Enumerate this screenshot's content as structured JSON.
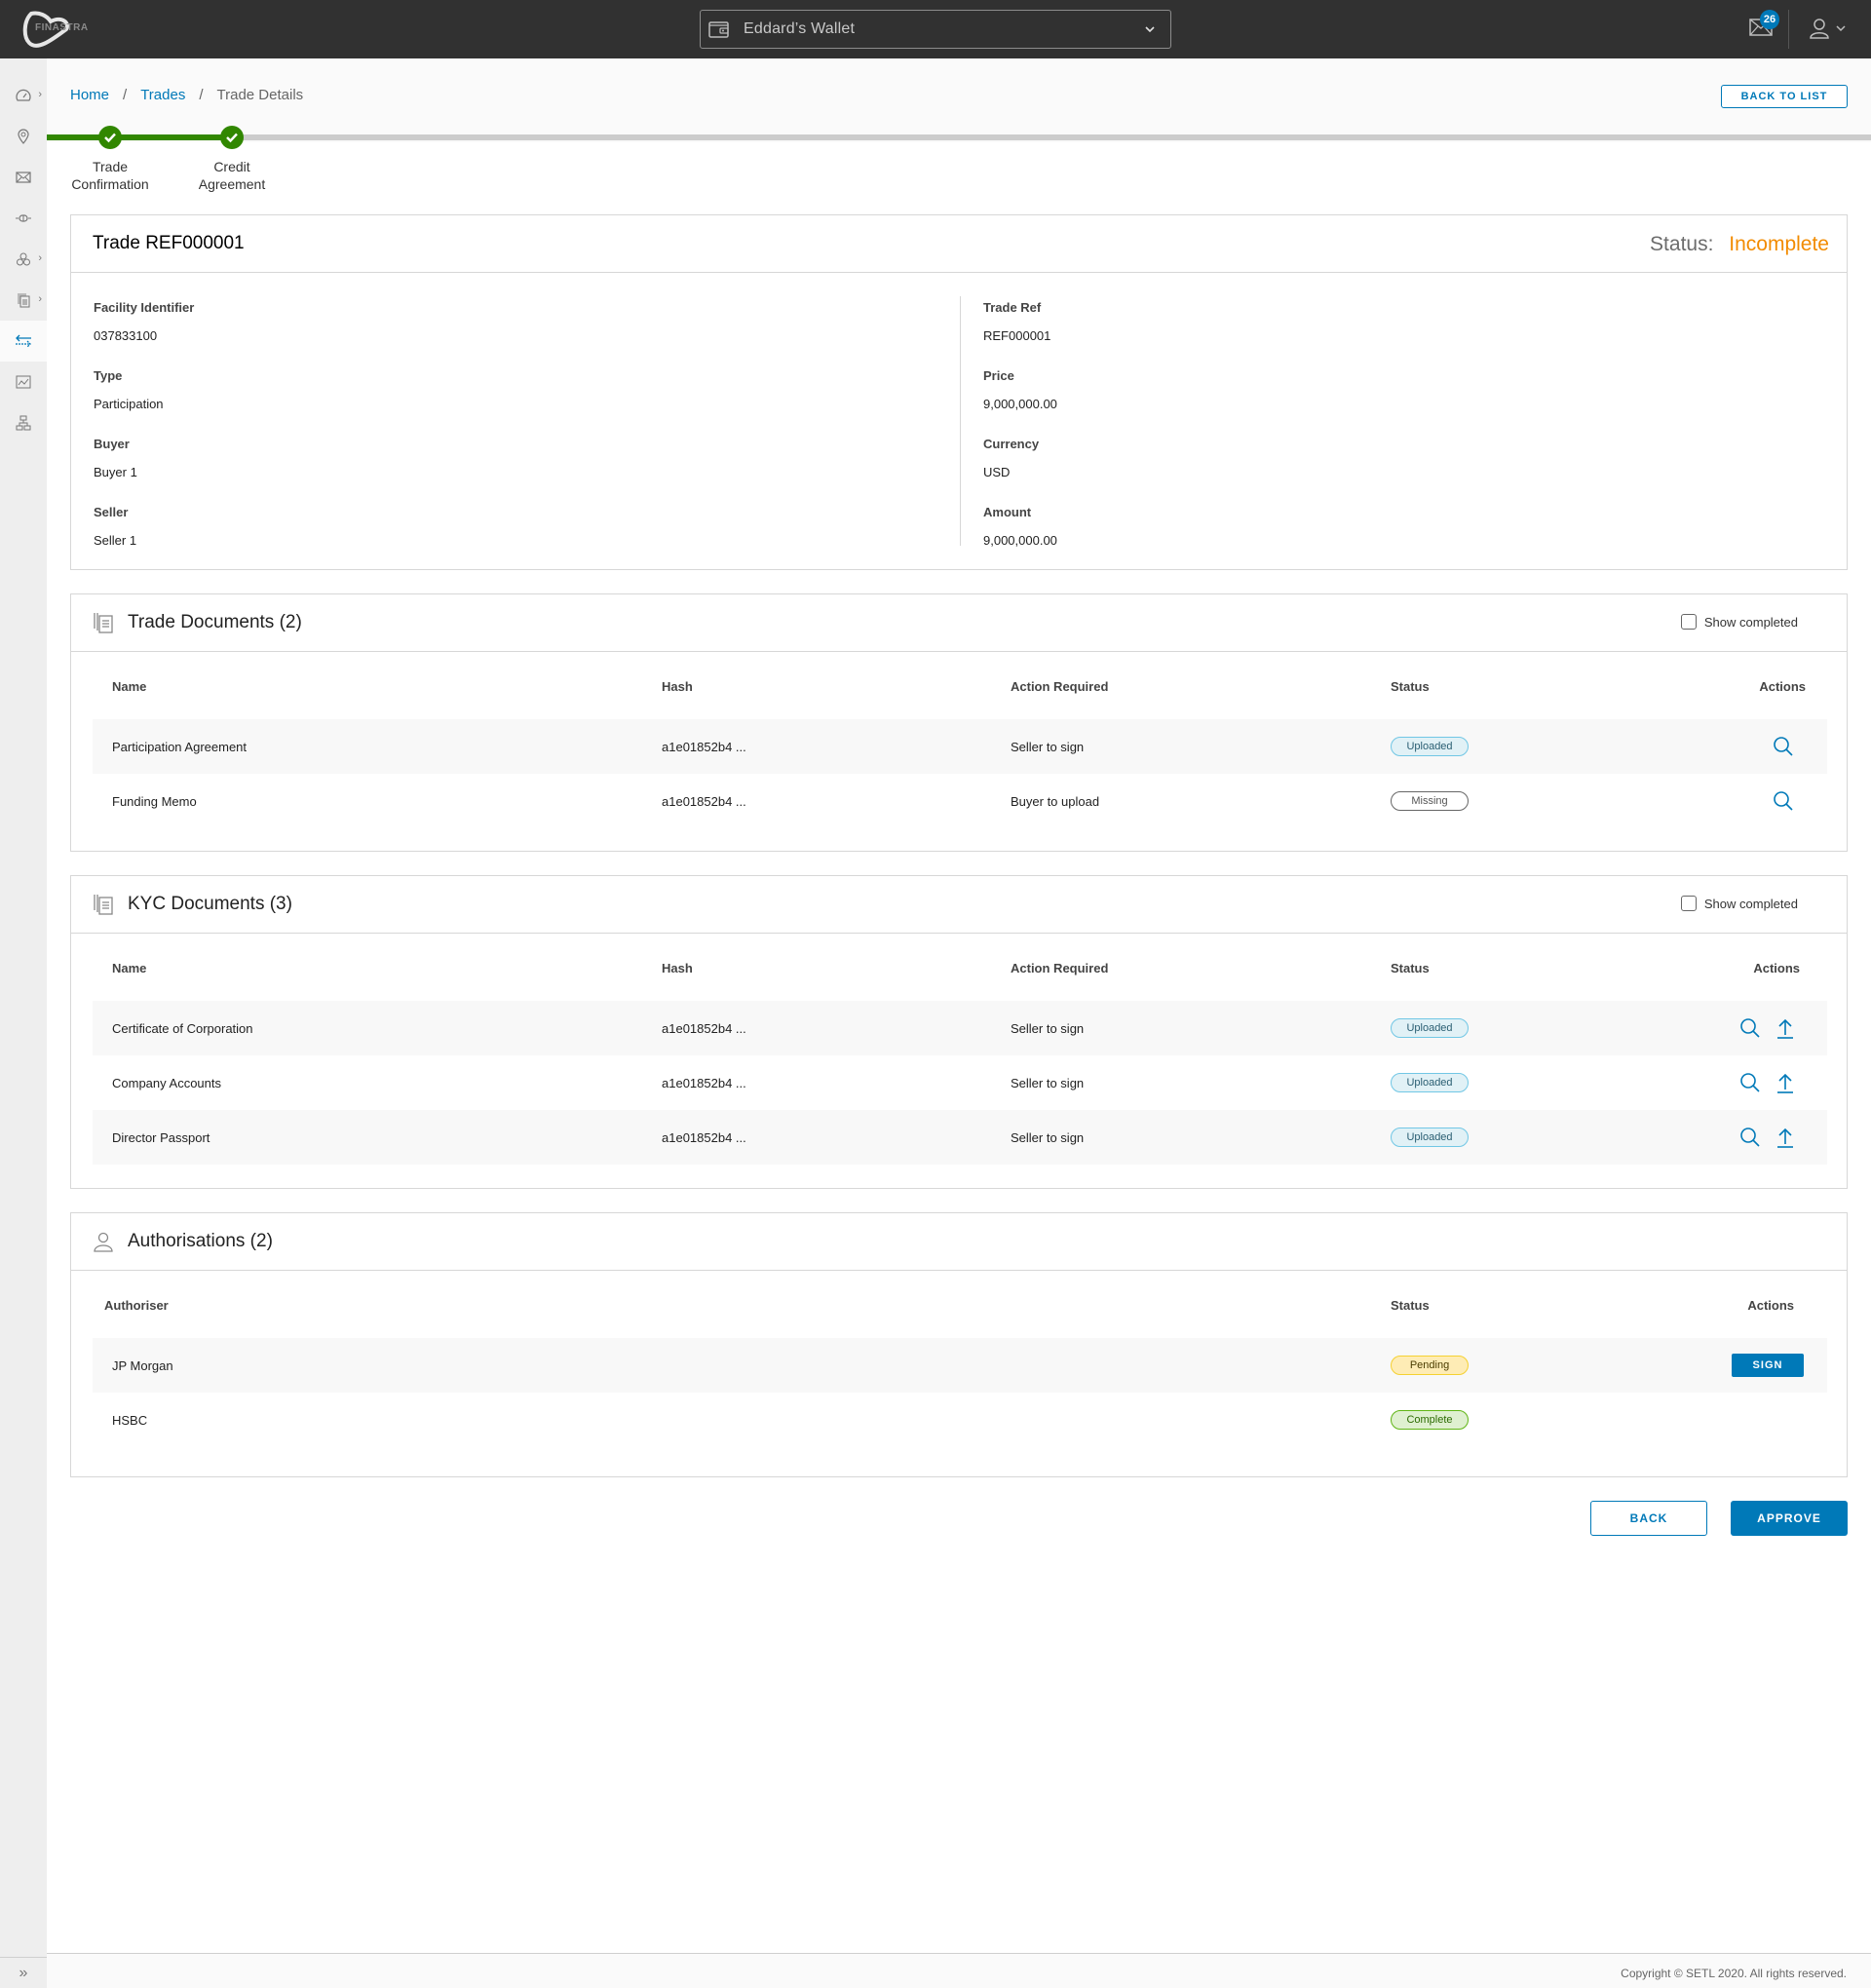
{
  "header": {
    "logo_text": "FINASTRA",
    "wallet_label": "Eddard’s Wallet",
    "notifications_count": "26"
  },
  "sidebar": {
    "items": [
      {
        "icon": "dashboard-icon",
        "has_submenu": true
      },
      {
        "icon": "location-pin-icon",
        "has_submenu": false
      },
      {
        "icon": "envelope-icon",
        "has_submenu": false
      },
      {
        "icon": "connector-icon",
        "has_submenu": false
      },
      {
        "icon": "blocks-icon",
        "has_submenu": true
      },
      {
        "icon": "documents-icon",
        "has_submenu": true
      },
      {
        "icon": "transfer-arrows-icon",
        "has_submenu": false,
        "active": true
      },
      {
        "icon": "line-chart-icon",
        "has_submenu": false
      },
      {
        "icon": "hierarchy-icon",
        "has_submenu": false
      }
    ],
    "collapse_glyph": "»"
  },
  "breadcrumb": {
    "items": [
      "Home",
      "Trades",
      "Trade Details"
    ],
    "separator": "/"
  },
  "back_to_list_label": "BACK TO LIST",
  "stepper": {
    "steps": [
      {
        "label_line1": "Trade",
        "label_line2": "Confirmation",
        "done": true
      },
      {
        "label_line1": "Credit",
        "label_line2": "Agreement",
        "done": true
      }
    ]
  },
  "trade": {
    "title": "Trade REF000001",
    "status_label": "Status:",
    "status_value": "Incomplete",
    "status_color": "#f28b00",
    "left_fields": [
      {
        "label": "Facility Identifier",
        "value": "037833100"
      },
      {
        "label": "Type",
        "value": "Participation"
      },
      {
        "label": "Buyer",
        "value": "Buyer 1"
      },
      {
        "label": "Seller",
        "value": "Seller 1"
      }
    ],
    "right_fields": [
      {
        "label": "Trade Ref",
        "value": "REF000001"
      },
      {
        "label": "Price",
        "value": "9,000,000.00"
      },
      {
        "label": "Currency",
        "value": "USD"
      },
      {
        "label": "Amount",
        "value": "9,000,000.00"
      }
    ]
  },
  "trade_documents": {
    "title": "Trade Documents (2)",
    "show_completed_label": "Show completed",
    "show_completed_checked": false,
    "columns": [
      "Name",
      "Hash",
      "Action Required",
      "Status",
      "Actions"
    ],
    "rows": [
      {
        "name": "Participation Agreement",
        "hash": "a1e01852b4 ...",
        "action": "Seller to sign",
        "status": "Uploaded"
      },
      {
        "name": "Funding Memo",
        "hash": "a1e01852b4 ...",
        "action": "Buyer to upload",
        "status": "Missing"
      }
    ]
  },
  "kyc_documents": {
    "title": "KYC Documents (3)",
    "show_completed_label": "Show completed",
    "show_completed_checked": false,
    "columns": [
      "Name",
      "Hash",
      "Action Required",
      "Status",
      "Actions"
    ],
    "rows": [
      {
        "name": "Certificate of Corporation",
        "hash": "a1e01852b4 ...",
        "action": "Seller to sign",
        "status": "Uploaded"
      },
      {
        "name": "Company Accounts",
        "hash": "a1e01852b4 ...",
        "action": "Seller to sign",
        "status": "Uploaded"
      },
      {
        "name": "Director Passport",
        "hash": "a1e01852b4 ...",
        "action": "Seller to sign",
        "status": "Uploaded"
      }
    ]
  },
  "authorisations": {
    "title": "Authorisations (2)",
    "columns": [
      "Authoriser",
      "Status",
      "Actions"
    ],
    "sign_label": "SIGN",
    "rows": [
      {
        "authoriser": "JP Morgan",
        "status": "Pending",
        "can_sign": true
      },
      {
        "authoriser": "HSBC",
        "status": "Complete",
        "can_sign": false
      }
    ]
  },
  "footer_buttons": {
    "back_label": "BACK",
    "approve_label": "APPROVE"
  },
  "footer": {
    "copyright": "Copyright © SETL 2020. All rights reserved."
  },
  "colors": {
    "primary": "#0079b8",
    "success": "#318700",
    "warning": "#f28b00",
    "header_bg": "#313131"
  }
}
